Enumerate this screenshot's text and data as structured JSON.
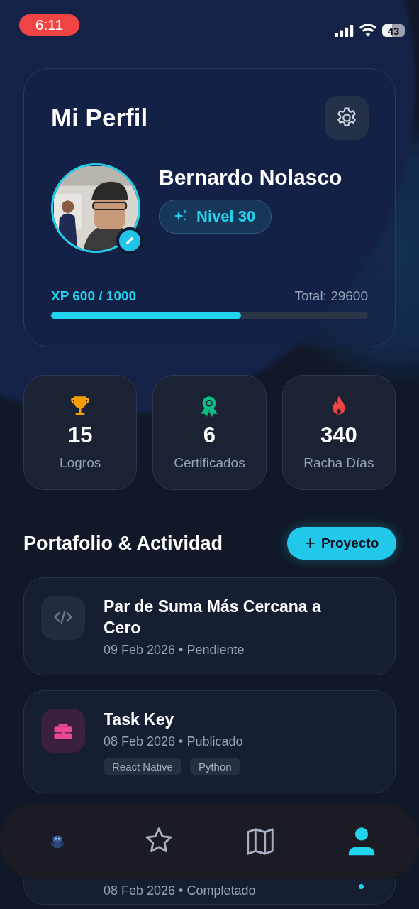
{
  "status_bar": {
    "time": "6:11",
    "battery": "43"
  },
  "profile": {
    "title": "Mi Perfil",
    "name": "Bernardo Nolasco",
    "level_badge": "Nivel 30",
    "xp_label": "XP 600 / 1000",
    "xp_total": "Total: 29600",
    "level": 0.6
  },
  "stats": [
    {
      "kind": "trophy",
      "color": "#f59e0b",
      "value": "15",
      "label": "Logros"
    },
    {
      "kind": "award",
      "color": "#10b981",
      "value": "6",
      "label": "Certificados"
    },
    {
      "kind": "flame",
      "color": "#ef4444",
      "value": "340",
      "label": "Racha Días"
    }
  ],
  "section": {
    "title": "Portafolio & Actividad",
    "button": "Proyecto",
    "button_icon": "+"
  },
  "projects": [
    {
      "kind": "code",
      "color": "#6b7a90",
      "title": "Par de Suma Más Cercana a Cero",
      "meta": "09 Feb 2026 • Pendiente"
    },
    {
      "kind": "briefcase",
      "color": "#ec4899",
      "title": "Task Key",
      "meta": "08 Feb 2026 • Publicado",
      "tags": [
        "React Native",
        "Python"
      ]
    },
    {
      "kind": "hidden",
      "meta": "08 Feb 2026 • Completado"
    }
  ],
  "nav": [
    {
      "kind": "robot",
      "selected": false
    },
    {
      "kind": "star",
      "selected": false
    },
    {
      "kind": "map",
      "selected": false
    },
    {
      "kind": "person",
      "selected": true
    }
  ]
}
